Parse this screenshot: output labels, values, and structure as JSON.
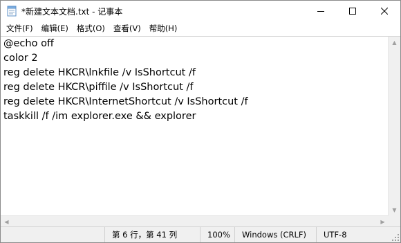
{
  "window": {
    "title": "*新建文本文档.txt - 记事本"
  },
  "menu": [
    {
      "label": "文件(F)"
    },
    {
      "label": "编辑(E)"
    },
    {
      "label": "格式(O)"
    },
    {
      "label": "查看(V)"
    },
    {
      "label": "帮助(H)"
    }
  ],
  "editor": {
    "lines": [
      "@echo off",
      "color 2",
      "reg delete HKCR\\lnkfile /v IsShortcut /f",
      "reg delete HKCR\\piffile /v IsShortcut /f",
      "reg delete HKCR\\InternetShortcut /v IsShortcut /f",
      "taskkill /f /im explorer.exe && explorer"
    ]
  },
  "status": {
    "position": "第 6 行，第 41 列",
    "zoom": "100%",
    "line_ending": "Windows (CRLF)",
    "encoding": "UTF-8"
  },
  "icons": {
    "app": "notepad-icon",
    "minimize": "minimize-icon",
    "maximize": "maximize-icon",
    "close": "close-icon"
  }
}
